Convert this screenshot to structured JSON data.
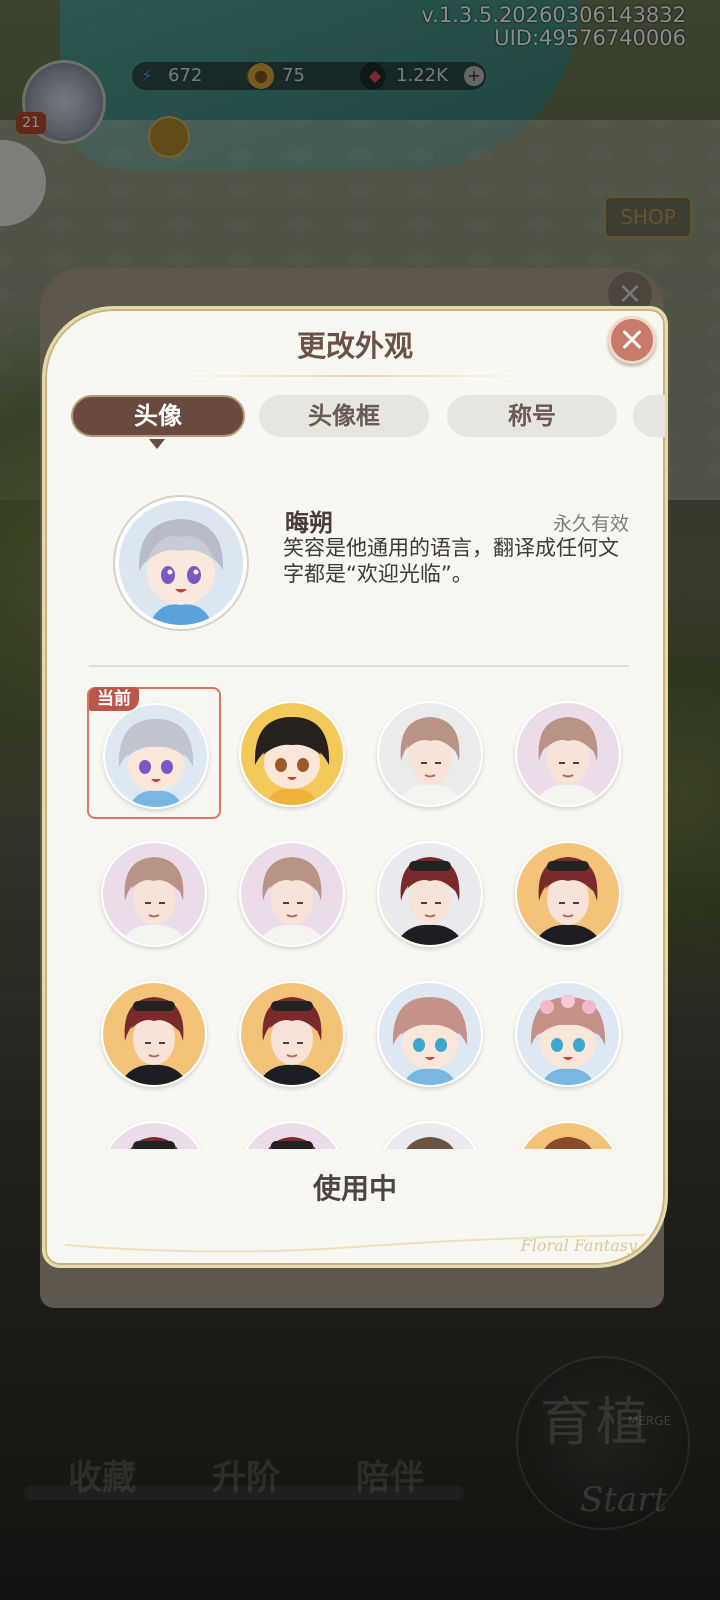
{
  "app": {
    "version": "v.1.3.5.20260306143832",
    "uid": "UID:49576740006",
    "level": "21"
  },
  "resources": [
    {
      "name": "energy",
      "value": "672",
      "icon": "lightning-icon"
    },
    {
      "name": "coins",
      "value": "75",
      "icon": "coin-icon"
    },
    {
      "name": "gems",
      "value": "1.22K",
      "icon": "gem-icon"
    }
  ],
  "scene": {
    "shop_label": "SHOP"
  },
  "bottom_nav": [
    {
      "label": "收藏",
      "locked": false
    },
    {
      "label": "升阶",
      "locked": true
    },
    {
      "label": "陪伴",
      "locked": true
    }
  ],
  "start_button": {
    "title": "育植",
    "sub": "MERGE",
    "script": "Start"
  },
  "dialog": {
    "title": "更改外观",
    "tabs": [
      {
        "label": "头像",
        "active": true
      },
      {
        "label": "头像框",
        "active": false
      },
      {
        "label": "称号",
        "active": false
      }
    ],
    "detail": {
      "name": "晦朔",
      "validity": "永久有效",
      "description": "笑容是他通用的语言，翻译成任何文字都是“欢迎光临”。"
    },
    "current_badge": "当前",
    "avatars": [
      {
        "style": "chibi-silver",
        "current": true,
        "bg": "#dde8f2"
      },
      {
        "style": "chibi-black-hair",
        "current": false,
        "bg": "#f3c95a"
      },
      {
        "style": "pink-hair-man",
        "current": false,
        "bg": "#ecebeb"
      },
      {
        "style": "pink-hair-man",
        "current": false,
        "bg": "#ecdcea"
      },
      {
        "style": "pink-hair-man",
        "current": false,
        "bg": "#ecdcea"
      },
      {
        "style": "pink-hair-man",
        "current": false,
        "bg": "#ecdcea"
      },
      {
        "style": "red-hair-man",
        "current": false,
        "bg": "#e9eaee"
      },
      {
        "style": "red-hair-man",
        "current": false,
        "bg": "#f3c37a"
      },
      {
        "style": "red-hair-man",
        "current": false,
        "bg": "#f3c37a"
      },
      {
        "style": "red-hair-man",
        "current": false,
        "bg": "#f3c37a"
      },
      {
        "style": "chibi-pink",
        "current": false,
        "bg": "#dde8f2"
      },
      {
        "style": "chibi-pink-flower",
        "current": false,
        "bg": "#dde8f2"
      },
      {
        "style": "red-hair-man",
        "current": false,
        "bg": "#ecdcea"
      },
      {
        "style": "red-hair-man",
        "current": false,
        "bg": "#ecdcea"
      },
      {
        "style": "brown-hair",
        "current": false,
        "bg": "#e9eaee"
      },
      {
        "style": "auburn-hair",
        "current": false,
        "bg": "#f3c37a"
      }
    ],
    "status": "使用中",
    "signature": "Floral Fantasy"
  }
}
